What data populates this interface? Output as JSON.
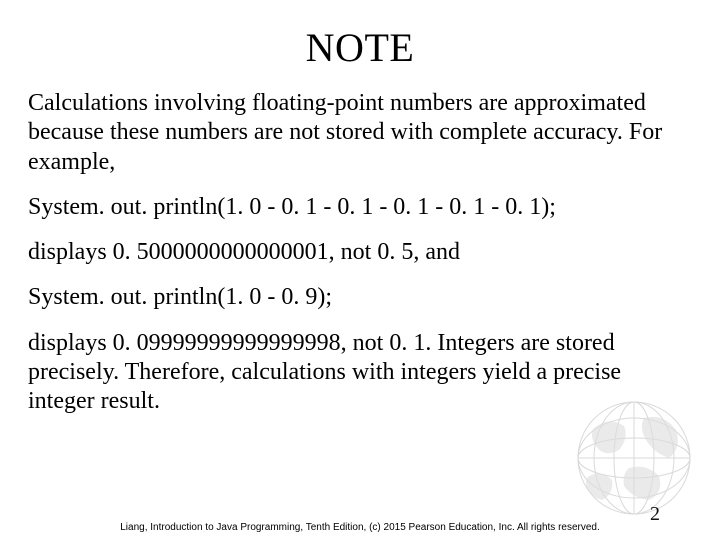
{
  "title": "NOTE",
  "paragraphs": {
    "p1": "Calculations involving floating-point numbers are approximated because these numbers are not stored with complete accuracy. For example,",
    "p2": "System. out. println(1. 0 - 0. 1 - 0. 1 - 0. 1 - 0. 1 - 0. 1);",
    "p3": "displays 0. 5000000000000001, not 0. 5, and",
    "p4": "System. out. println(1. 0 - 0. 9);",
    "p5": "displays 0. 09999999999999998, not 0. 1. Integers are stored precisely. Therefore, calculations with integers yield a precise integer result."
  },
  "footer": "Liang, Introduction to Java Programming, Tenth Edition, (c) 2015 Pearson Education, Inc. All rights reserved.",
  "page_number": "2"
}
